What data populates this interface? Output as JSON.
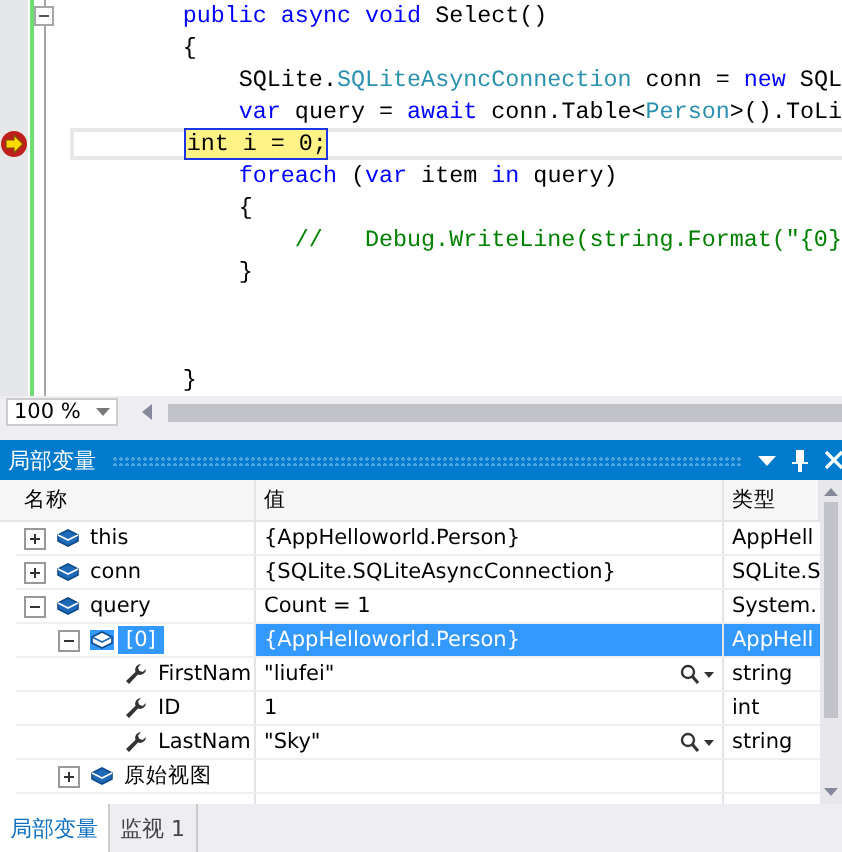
{
  "editor": {
    "lines": [
      {
        "tokens": [
          {
            "text": "public",
            "kind": "keyword"
          },
          {
            "text": " async",
            "kind": "keyword"
          },
          {
            "text": " void",
            "kind": "keyword"
          },
          {
            "text": " Select()",
            "kind": "plain"
          }
        ],
        "collapsible": true,
        "current": false
      },
      {
        "tokens": [
          {
            "text": "{",
            "kind": "plain"
          }
        ],
        "current": false
      },
      {
        "tokens": [
          {
            "text": "    SQLite.",
            "kind": "plain"
          },
          {
            "text": "SQLiteAsyncConnection",
            "kind": "type"
          },
          {
            "text": " conn = ",
            "kind": "plain"
          },
          {
            "text": "new",
            "kind": "keyword"
          },
          {
            "text": " SQL",
            "kind": "plain"
          }
        ],
        "current": false
      },
      {
        "tokens": [
          {
            "text": "    var",
            "kind": "keyword"
          },
          {
            "text": " query = ",
            "kind": "plain"
          },
          {
            "text": "await",
            "kind": "keyword"
          },
          {
            "text": " conn.Table<",
            "kind": "plain"
          },
          {
            "text": "Person",
            "kind": "type"
          },
          {
            "text": ">().ToLi",
            "kind": "plain"
          }
        ],
        "current": false
      },
      {
        "tokens": [
          {
            "text": "int i = 0;",
            "kind": "statement"
          }
        ],
        "current": true
      },
      {
        "tokens": [
          {
            "text": "    foreach",
            "kind": "keyword"
          },
          {
            "text": " (",
            "kind": "plain"
          },
          {
            "text": "var",
            "kind": "keyword"
          },
          {
            "text": " item ",
            "kind": "plain"
          },
          {
            "text": "in",
            "kind": "keyword"
          },
          {
            "text": " query)",
            "kind": "plain"
          }
        ],
        "current": false
      },
      {
        "tokens": [
          {
            "text": "    {",
            "kind": "plain"
          }
        ],
        "current": false
      },
      {
        "tokens": [
          {
            "text": "        //   Debug.WriteLine(string.Format(\"{0}",
            "kind": "comment"
          }
        ],
        "current": false
      },
      {
        "tokens": [
          {
            "text": "    }",
            "kind": "plain"
          }
        ],
        "current": false
      }
    ],
    "last_line": "}",
    "zoom": "100 %"
  },
  "locals": {
    "title": "局部变量",
    "columns": [
      "名称",
      "值",
      "类型"
    ],
    "rows": [
      {
        "name": "this",
        "value": "{AppHelloworld.Person}",
        "type": "AppHell",
        "kind": "object",
        "expanded": false,
        "selected": false
      },
      {
        "name": "conn",
        "value": "{SQLite.SQLiteAsyncConnection}",
        "type": "SQLite.S",
        "kind": "object",
        "expanded": false,
        "selected": false
      },
      {
        "name": "query",
        "value": "Count = 1",
        "type": "System.",
        "kind": "object",
        "expanded": true,
        "selected": false,
        "children": [
          {
            "name": "[0]",
            "value": "{AppHelloworld.Person}",
            "type": "AppHell",
            "kind": "object",
            "expanded": true,
            "selected": true,
            "children": [
              {
                "name": "FirstNam",
                "value": "\"liufei\"",
                "type": "string",
                "kind": "property",
                "selected": false,
                "visualizer": true
              },
              {
                "name": "ID",
                "value": "1",
                "type": "int",
                "kind": "property",
                "selected": false
              },
              {
                "name": "LastNam",
                "value": "\"Sky\"",
                "type": "string",
                "kind": "property",
                "selected": false,
                "visualizer": true
              }
            ]
          },
          {
            "name": "原始视图",
            "kind": "object",
            "expanded": false,
            "selected": false
          }
        ]
      }
    ]
  },
  "tabs": [
    {
      "label": "局部变量",
      "selected": true
    },
    {
      "label": "监视 1",
      "selected": false
    }
  ]
}
